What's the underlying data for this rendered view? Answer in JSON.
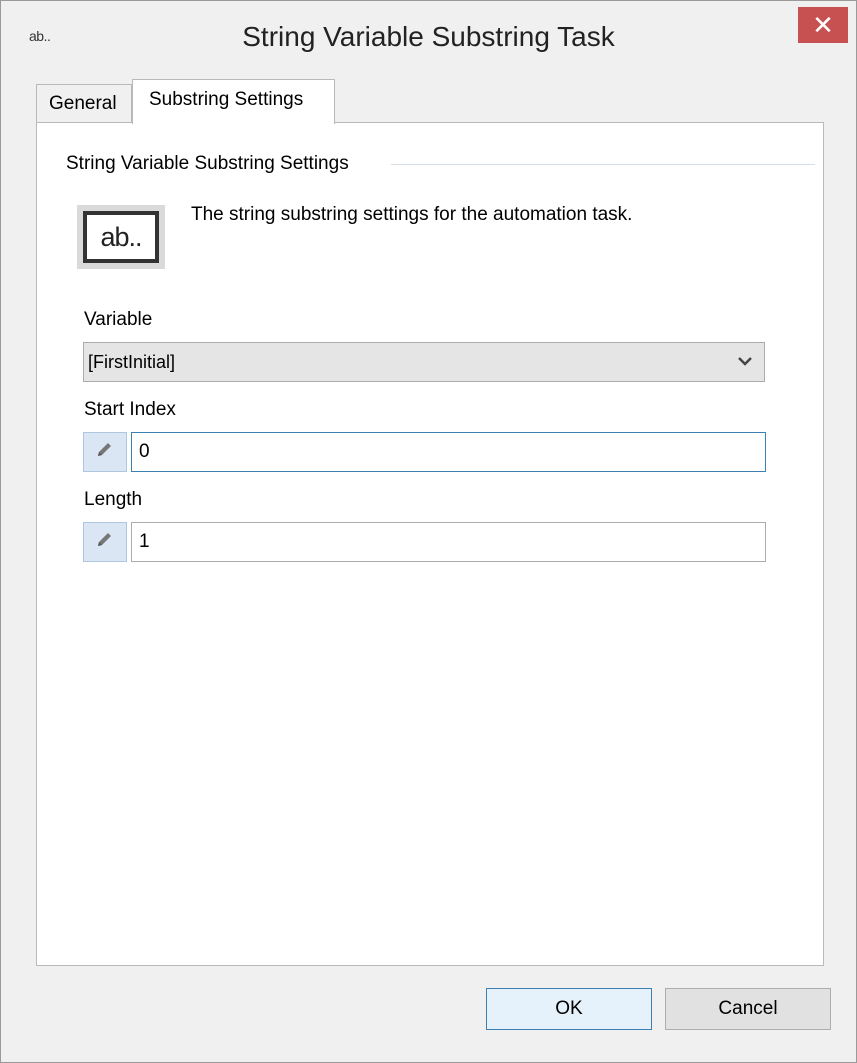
{
  "window": {
    "title": "String Variable Substring Task",
    "icon_text": "ab..",
    "close_label": "✕"
  },
  "tabs": [
    {
      "label": "General",
      "selected": false
    },
    {
      "label": "Substring Settings",
      "selected": true
    }
  ],
  "settings": {
    "group_title": "String Variable Substring Settings",
    "icon_text": "ab..",
    "description": "The string substring settings for the automation task."
  },
  "fields": {
    "variable": {
      "label": "Variable",
      "value": "[FirstInitial]"
    },
    "start_index": {
      "label": "Start Index",
      "value": "0"
    },
    "length": {
      "label": "Length",
      "value": "1"
    }
  },
  "buttons": {
    "ok": "OK",
    "cancel": "Cancel"
  },
  "icons": {
    "edit": "pencil-icon",
    "dropdown": "chevron-down-icon",
    "close": "close-icon"
  },
  "colors": {
    "close_button": "#c75050",
    "focus_border": "#3c7fb1",
    "edit_button_bg": "#dbe6f4"
  }
}
